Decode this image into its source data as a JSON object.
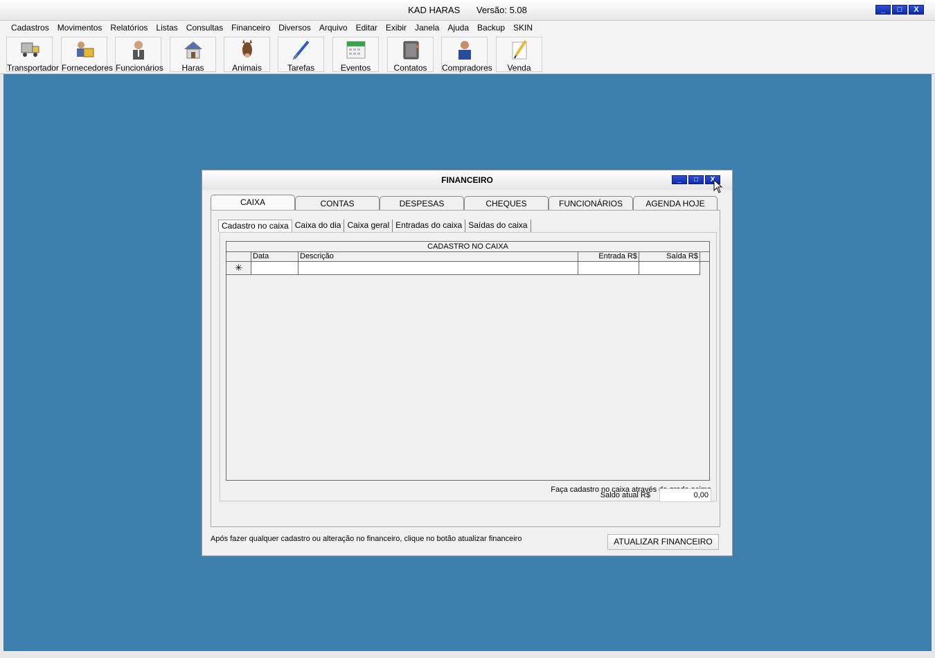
{
  "app": {
    "title": "KAD HARAS",
    "version": "Versão: 5.08",
    "window_buttons": [
      "_",
      "□",
      "X"
    ]
  },
  "menu": [
    "Cadastros",
    "Movimentos",
    "Relatórios",
    "Listas",
    "Consultas",
    "Financeiro",
    "Diversos",
    "Arquivo",
    "Editar",
    "Exibir",
    "Janela",
    "Ajuda",
    "Backup",
    "SKIN"
  ],
  "toolbar": [
    {
      "label": "Transportador",
      "icon": "truck-icon"
    },
    {
      "label": "Fornecedores",
      "icon": "suppliers-icon"
    },
    {
      "label": "Funcionários",
      "icon": "employee-icon"
    },
    {
      "label": "Haras",
      "icon": "house-icon"
    },
    {
      "label": "Animais",
      "icon": "horse-icon"
    },
    {
      "label": "Tarefas",
      "icon": "screwdriver-icon"
    },
    {
      "label": "Eventos",
      "icon": "calendar-icon"
    },
    {
      "label": "Contatos",
      "icon": "address-book-icon"
    },
    {
      "label": "Compradores",
      "icon": "buyer-icon"
    },
    {
      "label": "Venda",
      "icon": "pencil-note-icon"
    }
  ],
  "dialog": {
    "title": "FINANCEIRO",
    "tabs": [
      "CAIXA",
      "CONTAS",
      "DESPESAS",
      "CHEQUES",
      "FUNCIONÁRIOS",
      "AGENDA HOJE"
    ],
    "active_tab": "CAIXA",
    "subtabs": [
      "Cadastro no caixa",
      "Caixa do dia",
      "Caixa geral",
      "Entradas do caixa",
      "Saídas do caixa"
    ],
    "active_subtab": "Cadastro no caixa",
    "grid": {
      "caption": "CADASTRO NO CAIXA",
      "columns": [
        "Data",
        "Descrição",
        "Entrada R$",
        "Saída R$"
      ],
      "new_row_marker": "✳"
    },
    "hint": "Faça cadastro no caixa através da grade acima",
    "saldo_label": "Saldo atual R$",
    "saldo_value": "0,00",
    "footer_message": "Após fazer qualquer cadastro ou alteração no financeiro, clique no botão atualizar financeiro",
    "update_button": "ATUALIZAR FINANCEIRO"
  }
}
